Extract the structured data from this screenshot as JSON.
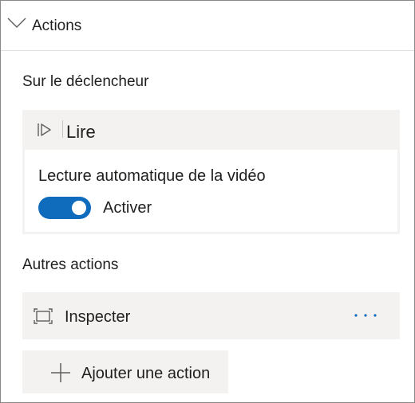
{
  "header": {
    "title": "Actions",
    "icon": "chevron-down-icon"
  },
  "trigger_section": {
    "label": "Sur le déclencheur",
    "action": {
      "icon": "play-icon",
      "label": "Lire",
      "option_label": "Lecture automatique de la vidéo",
      "toggle": {
        "on": true,
        "label": "Activer",
        "color": "#0f6cbd"
      }
    }
  },
  "other_section": {
    "label": "Autres actions",
    "items": [
      {
        "icon": "inspect-icon",
        "label": "Inspecter",
        "more_icon": "more-options-icon"
      }
    ]
  },
  "add_action": {
    "icon": "plus-icon",
    "label": "Ajouter une action"
  },
  "colors": {
    "accent": "#0f6cbd",
    "card_background": "#f3f2f1",
    "border": "#8a8886"
  }
}
